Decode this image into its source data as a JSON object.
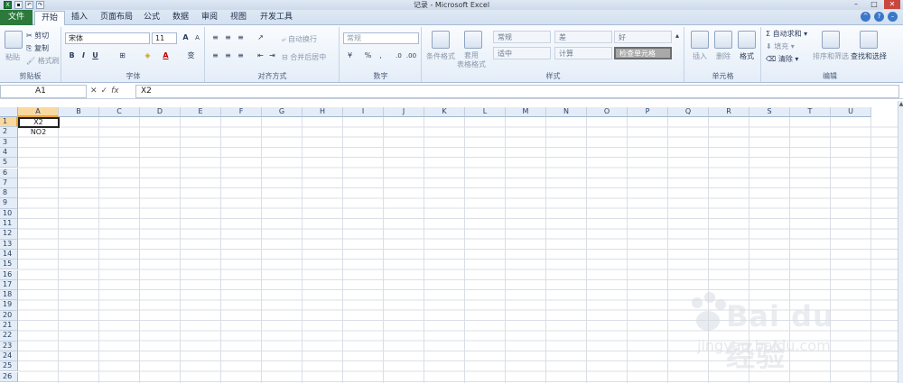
{
  "window": {
    "title": "记录 - Microsoft Excel"
  },
  "tabs": [
    "文件",
    "开始",
    "插入",
    "页面布局",
    "公式",
    "数据",
    "审阅",
    "视图",
    "开发工具"
  ],
  "ribbon": {
    "clipboard": {
      "paste": "粘贴",
      "cut": "剪切",
      "copy": "复制",
      "format_painter": "格式刷",
      "label": "剪贴板"
    },
    "font": {
      "name": "宋体",
      "size": "11",
      "label": "字体",
      "bold": "B",
      "italic": "I",
      "underline": "U",
      "grow": "A",
      "shrink": "A",
      "color_a": "A",
      "wen": "变"
    },
    "alignment": {
      "wrap": "自动换行",
      "merge": "合并后居中",
      "label": "对齐方式"
    },
    "number": {
      "format": "常规",
      "percent": "%",
      "comma": ",",
      "label": "数字"
    },
    "styles": {
      "conditional": "条件格式",
      "table": "套用\n表格格式",
      "label": "样式",
      "cells": [
        "常规",
        "差",
        "好",
        "适中",
        "计算",
        "检查单元格"
      ]
    },
    "cells_group": {
      "insert": "插入",
      "delete": "删除",
      "format": "格式",
      "label": "单元格"
    },
    "editing": {
      "autosum": "自动求和",
      "fill": "填充",
      "clear": "清除",
      "sort": "排序和筛选",
      "find": "查找和选择",
      "label": "编辑"
    }
  },
  "formula_bar": {
    "name_box": "A1",
    "fx": "fx",
    "value": "X2"
  },
  "sheet": {
    "columns": [
      "A",
      "B",
      "C",
      "D",
      "E",
      "F",
      "G",
      "H",
      "I",
      "J",
      "K",
      "L",
      "M",
      "N",
      "O",
      "P",
      "Q",
      "R",
      "S",
      "T",
      "U"
    ],
    "rows": [
      "1",
      "2",
      "3",
      "4",
      "5",
      "6",
      "7",
      "8",
      "9",
      "10",
      "11",
      "12",
      "13",
      "14",
      "15",
      "16",
      "17",
      "18",
      "19",
      "20",
      "21",
      "22",
      "23",
      "24",
      "25",
      "26"
    ],
    "selected_cell": "A1",
    "values": {
      "A1": "X2",
      "A2": "NO2"
    }
  },
  "watermark": {
    "brand": "Bai du 经验",
    "url": "jingyan.baidu.com"
  }
}
